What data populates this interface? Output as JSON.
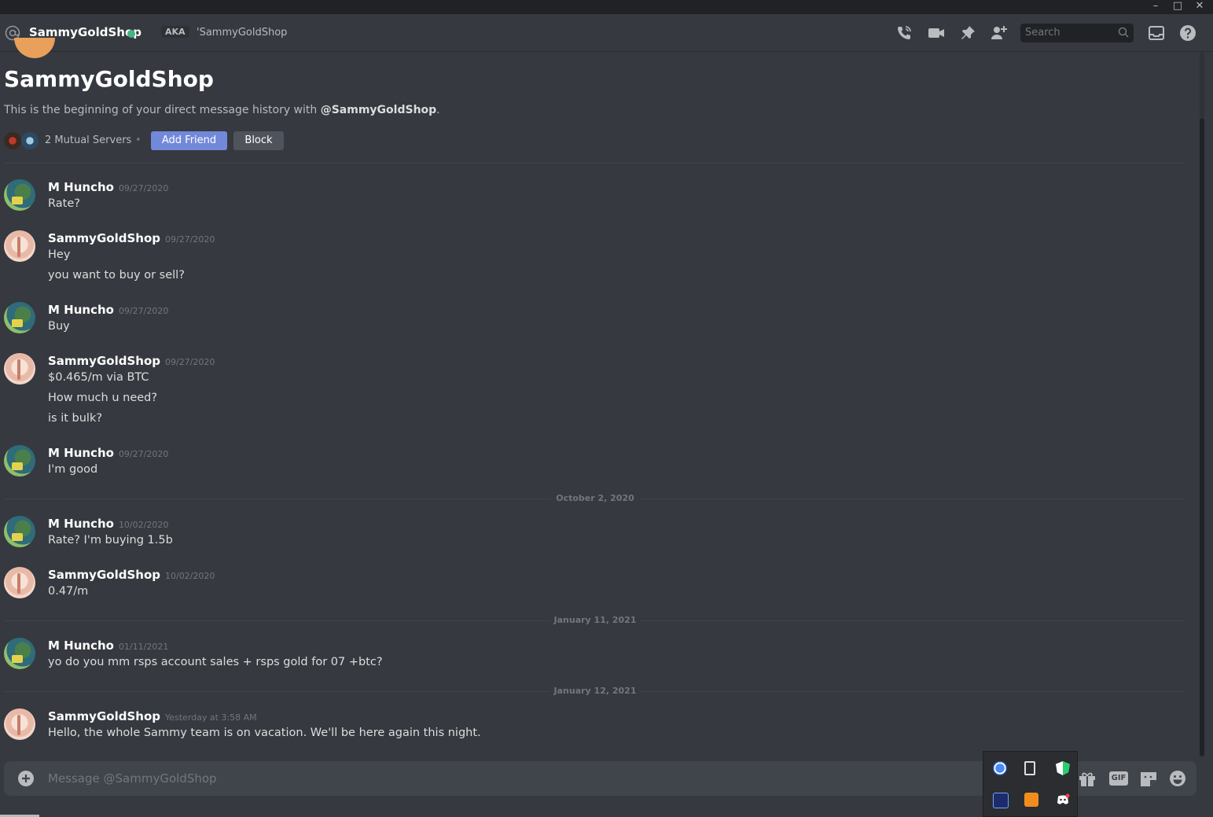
{
  "header": {
    "name": "SammyGoldShop",
    "aka_label": "AKA",
    "aka_name": "'SammyGoldShop",
    "search_placeholder": "Search"
  },
  "intro": {
    "title": "SammyGoldShop",
    "desc_prefix": "This is the beginning of your direct message history with ",
    "desc_handle": "@SammyGoldShop",
    "desc_suffix": ".",
    "mutual_servers": "2 Mutual Servers",
    "sep": "•",
    "add_friend": "Add Friend",
    "block": "Block"
  },
  "messages": [
    {
      "author": "M Huncho",
      "time": "09/27/2020",
      "lines": [
        "Rate?"
      ]
    },
    {
      "author": "SammyGoldShop",
      "time": "09/27/2020",
      "lines": [
        "Hey",
        "you want to buy or sell?"
      ]
    },
    {
      "author": "M Huncho",
      "time": "09/27/2020",
      "lines": [
        "Buy"
      ]
    },
    {
      "author": "SammyGoldShop",
      "time": "09/27/2020",
      "lines": [
        "$0.465/m via BTC",
        "How much u need?",
        "is it bulk?"
      ]
    },
    {
      "author": "M Huncho",
      "time": "09/27/2020",
      "lines": [
        "I'm good"
      ]
    },
    {
      "author": "M Huncho",
      "time": "10/02/2020",
      "lines": [
        "Rate? I'm buying 1.5b"
      ]
    },
    {
      "author": "SammyGoldShop",
      "time": "10/02/2020",
      "lines": [
        "0.47/m"
      ]
    },
    {
      "author": "M Huncho",
      "time": "01/11/2021",
      "lines": [
        "yo do you mm rsps account sales + rsps gold for 07 +btc?"
      ]
    },
    {
      "author": "SammyGoldShop",
      "time": "Yesterday at 3:58 AM",
      "lines": [
        "Hello, the whole Sammy team is on vacation.  We'll be here again this night."
      ]
    }
  ],
  "dividers": [
    "October 2, 2020",
    "January 11, 2021",
    "January 12, 2021"
  ],
  "composer": {
    "placeholder": "Message @SammyGoldShop",
    "gif_label": "GIF"
  },
  "colors": {
    "accent": "#7289da",
    "online": "#43b581",
    "background": "#36393f"
  }
}
